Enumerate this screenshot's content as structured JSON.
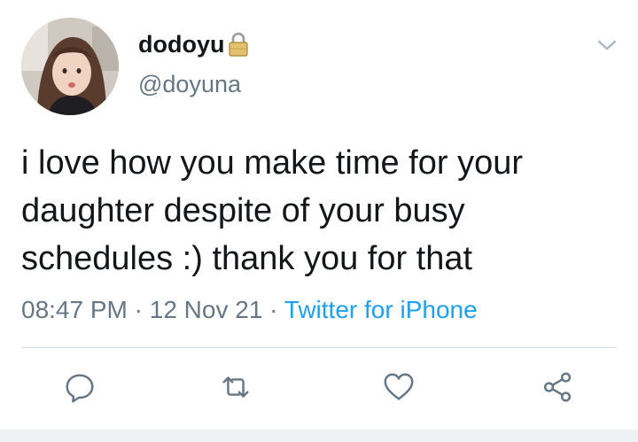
{
  "user": {
    "display_name": "dodoyu",
    "handle": "@doyuna",
    "protected_icon": "lock-icon"
  },
  "tweet": {
    "text_lines": [
      "i love how you make time for your",
      "daughter despite of your busy",
      "schedules :) thank you for that"
    ],
    "time": "08:47 PM",
    "separator": "·",
    "date": "12 Nov 21",
    "source": "Twitter for iPhone"
  },
  "actions": {
    "icons": [
      "reply-icon",
      "retweet-icon",
      "like-icon",
      "share-icon"
    ]
  },
  "colors": {
    "text": "#14171a",
    "secondary": "#657786",
    "accent": "#1da1f2",
    "divider": "#d5dbe0"
  }
}
